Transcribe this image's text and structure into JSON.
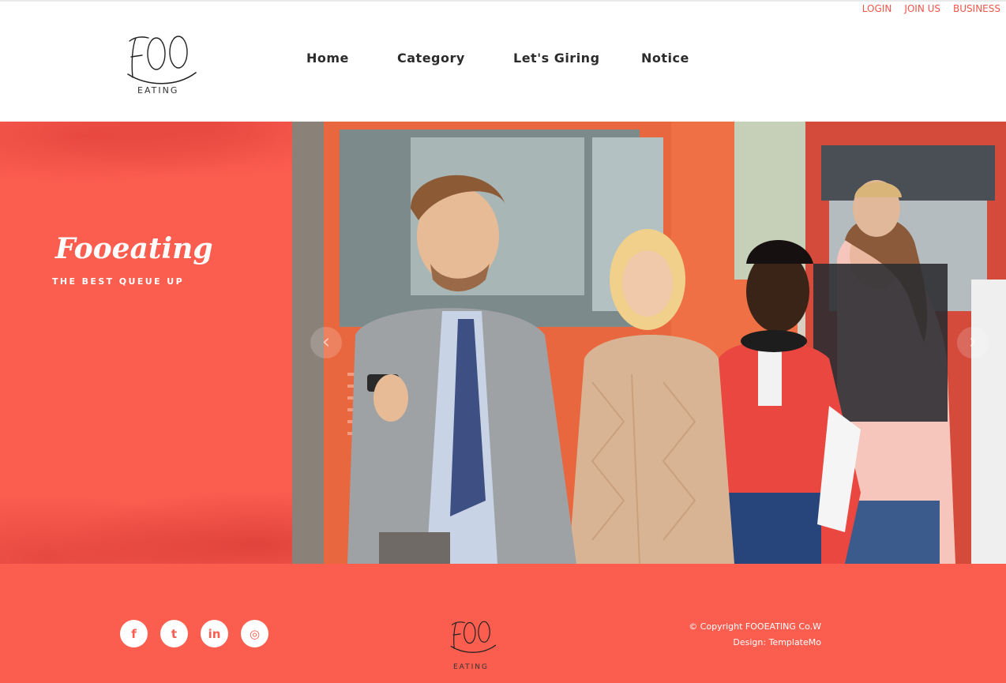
{
  "top_links": [
    "LOGIN",
    "JOIN US",
    "BUSINESS"
  ],
  "logo": {
    "main": "FOO",
    "sub": "EATING"
  },
  "nav": [
    "Home",
    "Category",
    "Let's Giring",
    "Notice"
  ],
  "hero": {
    "title": "Fooeating",
    "subtitle": "THE BEST QUEUE UP",
    "prev_icon": "chevron-left-icon",
    "next_icon": "chevron-right-icon",
    "prev_glyph": "‹",
    "next_glyph": "›"
  },
  "footer": {
    "social": [
      {
        "icon": "facebook-icon",
        "glyph": "f"
      },
      {
        "icon": "twitter-icon",
        "glyph": "t"
      },
      {
        "icon": "linkedin-icon",
        "glyph": "in"
      },
      {
        "icon": "instagram-icon",
        "glyph": "◎"
      }
    ],
    "copyright": "© Copyright FOOEATING Co.W",
    "design": "Design: TemplateMo"
  },
  "colors": {
    "accent": "#fb5d4f",
    "link": "#f0564a",
    "text": "#2b2b2b"
  }
}
